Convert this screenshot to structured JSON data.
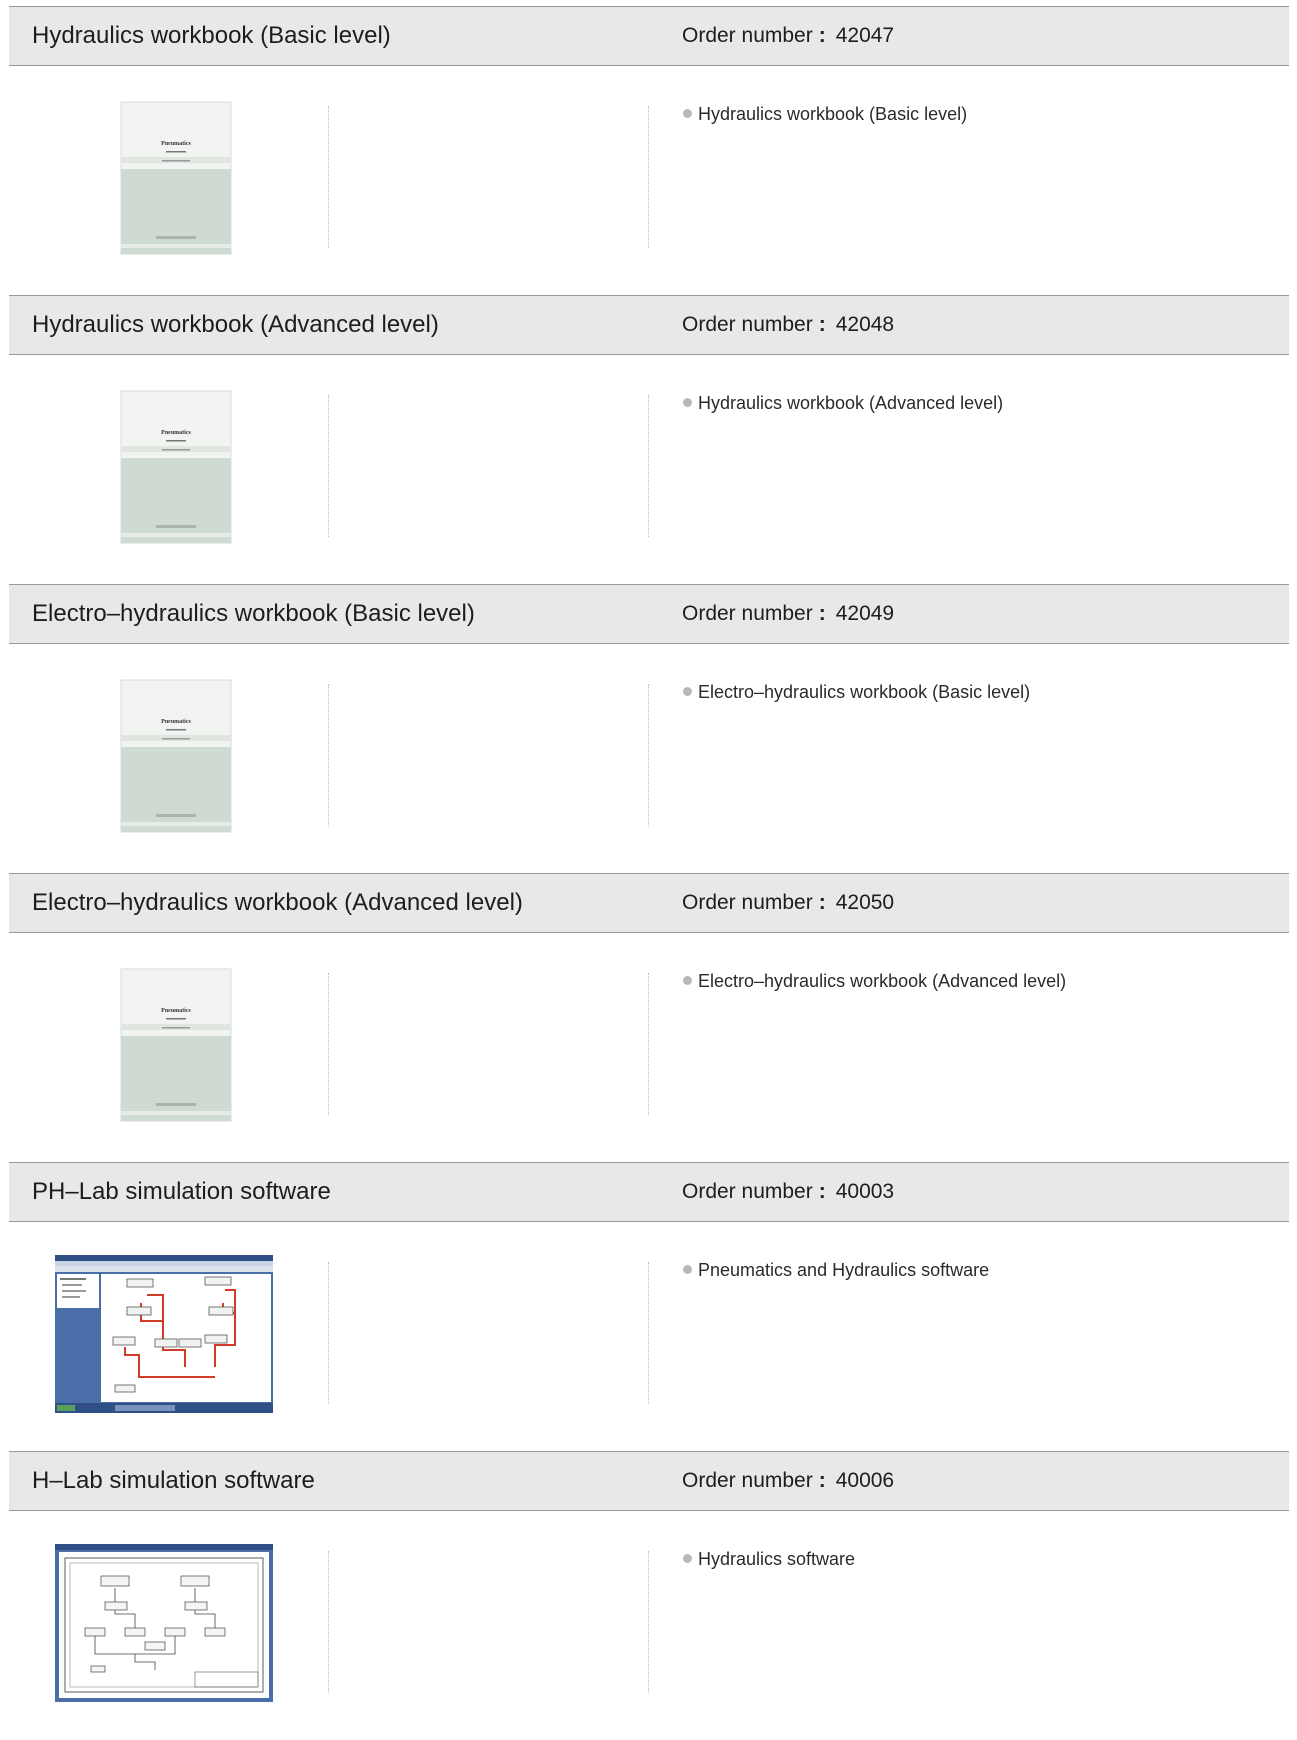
{
  "products": [
    {
      "title": "Hydraulics workbook (Basic level)",
      "order_label": "Order number",
      "order_number": "42047",
      "features": [
        "Hydraulics workbook (Basic level)"
      ],
      "thumb_type": "book",
      "thumb_text": "Pneumatics"
    },
    {
      "title": "Hydraulics workbook (Advanced level)",
      "order_label": "Order number",
      "order_number": "42048",
      "features": [
        "Hydraulics workbook (Advanced level)"
      ],
      "thumb_type": "book",
      "thumb_text": "Pneumatics"
    },
    {
      "title": "Electro–hydraulics workbook (Basic level)",
      "order_label": "Order number",
      "order_number": "42049",
      "features": [
        "Electro–hydraulics workbook (Basic level)"
      ],
      "thumb_type": "book",
      "thumb_text": "Pneumatics"
    },
    {
      "title": "Electro–hydraulics workbook (Advanced level)",
      "order_label": "Order number",
      "order_number": "42050",
      "features": [
        "Electro–hydraulics workbook (Advanced level)"
      ],
      "thumb_type": "book",
      "thumb_text": "Pneumatics"
    },
    {
      "title": "PH–Lab simulation software",
      "order_label": "Order number",
      "order_number": "40003",
      "features": [
        "Pneumatics and Hydraulics software"
      ],
      "thumb_type": "software-color"
    },
    {
      "title": "H–Lab simulation software",
      "order_label": "Order number",
      "order_number": "40006",
      "features": [
        "Hydraulics software"
      ],
      "thumb_type": "software-drawing"
    }
  ],
  "colors": {
    "header_bg": "#e8e8ea",
    "rule": "#9a9a9c",
    "circuit_red": "#d23a2a",
    "window_blue": "#4a6fa8"
  }
}
